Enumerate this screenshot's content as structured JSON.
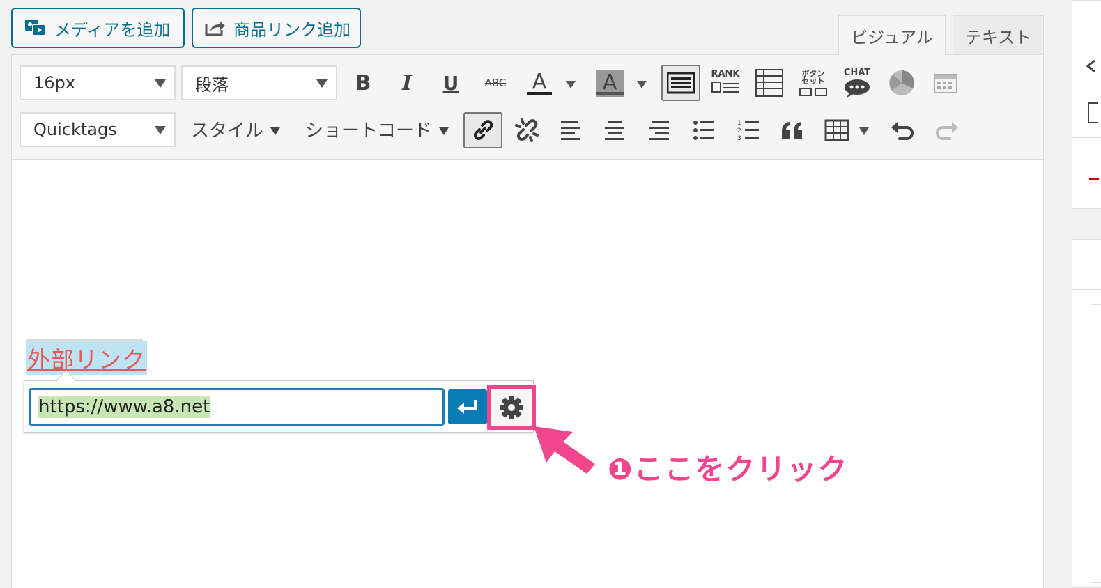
{
  "media_buttons": {
    "add_media": "メディアを追加",
    "add_product_link": "商品リンク追加"
  },
  "editor_tabs": {
    "visual": "ビジュアル",
    "text": "テキスト"
  },
  "toolbar": {
    "font_size": "16px",
    "paragraph": "段落",
    "quicktags": "Quicktags",
    "style_menu": "スタイル",
    "shortcode_menu": "ショートコード",
    "rank_label": "RANK",
    "button_set_label_1": "ボタン",
    "button_set_label_2": "セット",
    "chat_label": "CHAT",
    "strike_label": "ABC"
  },
  "content": {
    "link_text": "外部リンク"
  },
  "link_popup": {
    "url_value": "https://www.a8.net"
  },
  "annotation": {
    "callout": "❶ここをクリック",
    "highlight_color": "#f0468e"
  },
  "colors": {
    "accent": "#0a6c8f",
    "apply_button": "#0a7cb3",
    "link_text": "#e55a5a"
  }
}
